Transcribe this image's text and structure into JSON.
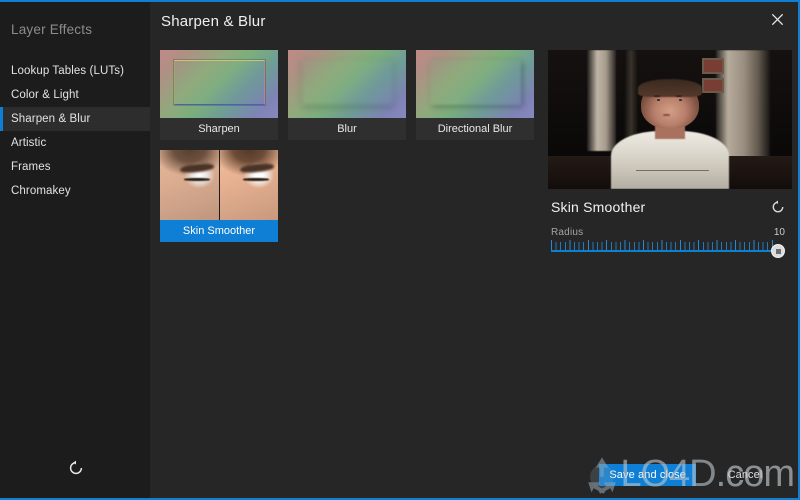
{
  "window": {
    "accent_color": "#0e7fd4",
    "background": "#262626",
    "sidebar_background": "#1c1c1c",
    "close_icon": "close-icon"
  },
  "sidebar": {
    "title": "Layer Effects",
    "items": [
      {
        "label": "Lookup Tables (LUTs)",
        "selected": false
      },
      {
        "label": "Color & Light",
        "selected": false
      },
      {
        "label": "Sharpen & Blur",
        "selected": true
      },
      {
        "label": "Artistic",
        "selected": false
      },
      {
        "label": "Frames",
        "selected": false
      },
      {
        "label": "Chromakey",
        "selected": false
      }
    ],
    "reset_icon": "reset-icon"
  },
  "main": {
    "title": "Sharpen & Blur",
    "effects": [
      {
        "label": "Sharpen",
        "selected": false,
        "thumb": "gradient-sharpen"
      },
      {
        "label": "Blur",
        "selected": false,
        "thumb": "gradient-blur"
      },
      {
        "label": "Directional Blur",
        "selected": false,
        "thumb": "gradient-directional-blur"
      },
      {
        "label": "Skin Smoother",
        "selected": true,
        "thumb": "face-before-after"
      }
    ]
  },
  "preview": {
    "image_alt": "webcam-photo-man-in-white-tshirt",
    "setting_title": "Skin Smoother",
    "reset_icon": "reset-icon",
    "slider": {
      "name": "Radius",
      "value": "10",
      "min": 0,
      "max": 10,
      "percent": 100
    }
  },
  "footer": {
    "save_label": "Save and close",
    "cancel_label": "Cancel"
  },
  "watermark": {
    "text_main": "LO4D",
    "text_suffix": ".com",
    "logo_icon": "recycle-arrows-icon"
  }
}
